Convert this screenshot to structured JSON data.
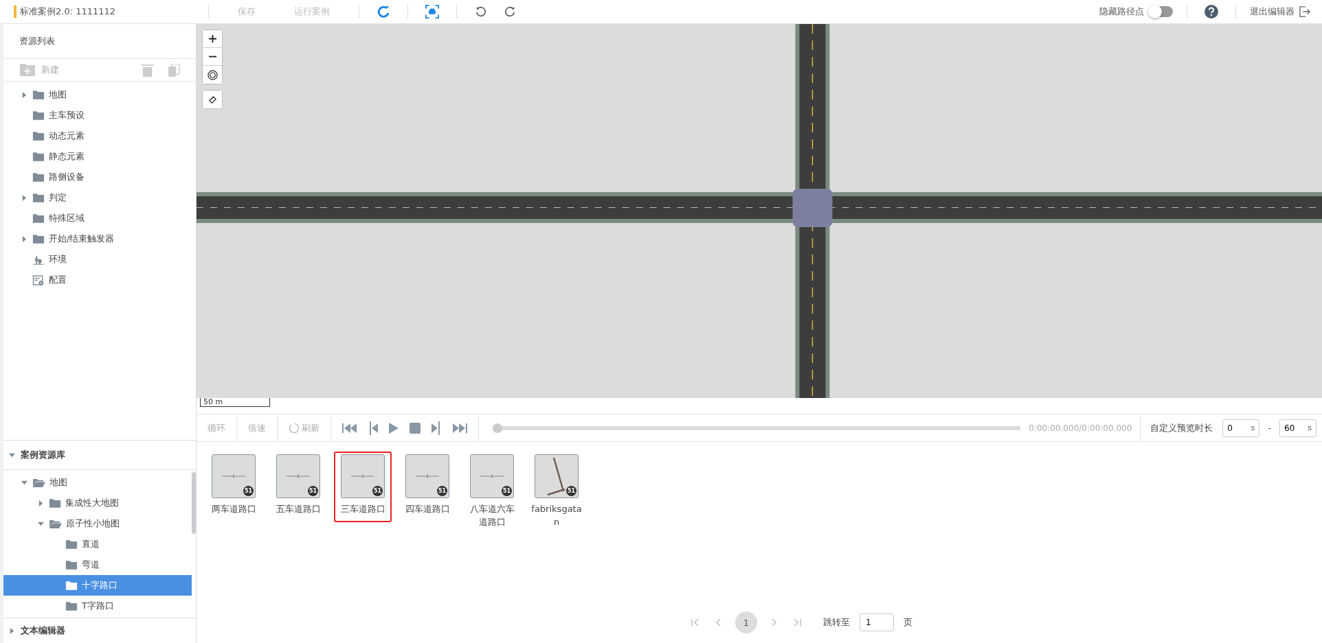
{
  "top_bar": {
    "title": "标准案例2.0: 1111112",
    "actions": [
      {
        "label": "保存",
        "disabled": true
      },
      {
        "label": "运行案例",
        "disabled": true
      }
    ],
    "hide_waypoints": {
      "label": "隐藏路径点",
      "on": false
    },
    "exit": "退出编辑器"
  },
  "resource_list": {
    "title": "资源列表",
    "new_label": "新建",
    "items": [
      {
        "label": "地图",
        "kind": "folder",
        "expandable": true
      },
      {
        "label": "主车预设",
        "kind": "folder",
        "expandable": false
      },
      {
        "label": "动态元素",
        "kind": "folder",
        "expandable": false
      },
      {
        "label": "静态元素",
        "kind": "folder",
        "expandable": false
      },
      {
        "label": "路侧设备",
        "kind": "folder",
        "expandable": false
      },
      {
        "label": "判定",
        "kind": "folder",
        "expandable": true
      },
      {
        "label": "特殊区域",
        "kind": "folder",
        "expandable": false
      },
      {
        "label": "开始/结束触发器",
        "kind": "folder",
        "expandable": true
      },
      {
        "label": "环境",
        "kind": "environment",
        "expandable": false
      },
      {
        "label": "配置",
        "kind": "config",
        "expandable": false
      }
    ]
  },
  "map": {
    "scale": "50 m"
  },
  "playback": {
    "loop": "循环",
    "speed": "倍速",
    "refresh": "刷新",
    "level": 0,
    "time": "0:00:00.000/0:00:00.000",
    "custom_label": "自定义预览时长",
    "start": "0",
    "end": "60",
    "unit_start": "s",
    "unit_end": "s",
    "separator": "-"
  },
  "case_library": {
    "title": "案例资源库",
    "expanded": true,
    "tree": [
      {
        "label": "地图",
        "expanded": true,
        "selected": false,
        "children": [
          {
            "label": "集成性大地图",
            "expanded": false,
            "selected": false
          },
          {
            "label": "原子性小地图",
            "expanded": true,
            "selected": false,
            "children": [
              {
                "label": "直道",
                "selected": false
              },
              {
                "label": "弯道",
                "selected": false
              },
              {
                "label": "十字路口",
                "selected": true
              },
              {
                "label": "T字路口",
                "selected": false
              }
            ]
          }
        ]
      }
    ]
  },
  "thumbnails": [
    {
      "label": "两车道路口",
      "badge": "51",
      "kind": "cross",
      "selected": false
    },
    {
      "label": "五车道路口",
      "badge": "51",
      "kind": "cross",
      "selected": false
    },
    {
      "label": "三车道路口",
      "badge": "51",
      "kind": "cross",
      "selected": true
    },
    {
      "label": "四车道路口",
      "badge": "51",
      "kind": "cross",
      "selected": false
    },
    {
      "label": "八车道六车道路口",
      "badge": "51",
      "kind": "cross",
      "selected": false
    },
    {
      "label": "fabriksgatan",
      "badge": "51",
      "kind": "diagonal",
      "selected": false
    }
  ],
  "pagination": {
    "page": "1",
    "jump_label": "跳转至",
    "jump_value": "1",
    "suffix": "页"
  },
  "text_editor": {
    "title": "文本编辑器",
    "expanded": false
  }
}
